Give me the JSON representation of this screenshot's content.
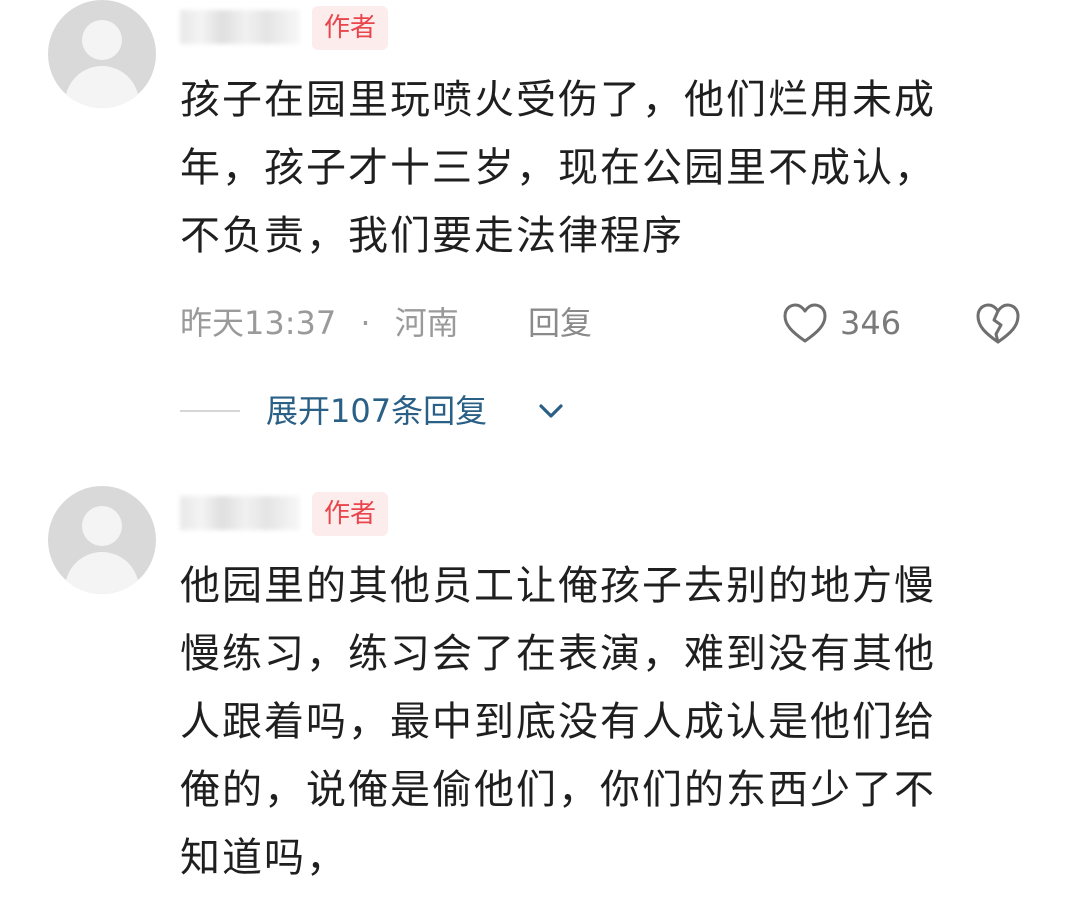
{
  "comments": [
    {
      "badge": "作者",
      "lines": [
        "孩子在园里玩喷火受伤了，他们烂用未成",
        "年，孩子才十三岁，现在公园里不成认，",
        "不负责，我们要走法律程序"
      ],
      "time": "昨天13:37",
      "sep": "·",
      "location": "河南",
      "reply_label": "回复",
      "likes": "346",
      "expand_label": "展开107条回复"
    },
    {
      "badge": "作者",
      "lines": [
        "他园里的其他员工让俺孩子去别的地方慢",
        "慢练习，练习会了在表演，难到没有其他",
        "人跟着吗，最中到底没有人成认是他们给",
        "俺的，说俺是偷他们，你们的东西少了不",
        "知道吗，"
      ]
    }
  ],
  "icons": {
    "like": "heart-outline-icon",
    "dislike": "broken-heart-icon",
    "expand": "chevron-down-icon"
  },
  "colors": {
    "badge_text": "#e8454d",
    "badge_bg": "#fdecec",
    "link": "#2a5f86",
    "meta": "#9a9a9a"
  }
}
